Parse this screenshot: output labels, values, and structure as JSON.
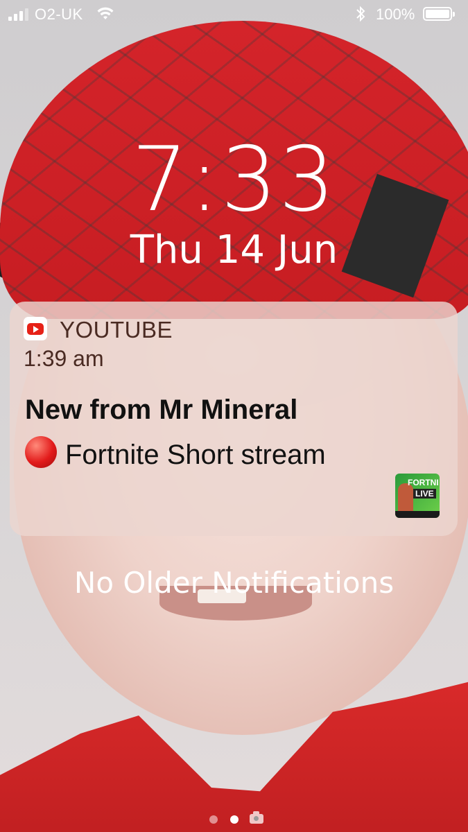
{
  "status_bar": {
    "carrier": "O2-UK",
    "signal_bars": 3,
    "signal_bars_total": 4,
    "wifi_icon": "wifi-icon",
    "bluetooth_icon": "bluetooth-icon",
    "battery_percent": "100%",
    "battery_level": 1.0
  },
  "lock_screen": {
    "time": "7:33",
    "date": "Thu 14 Jun"
  },
  "notification": {
    "app_name": "YOUTUBE",
    "app_icon": "youtube-icon",
    "time": "1:39 am",
    "title": "New from Mr Mineral",
    "body": "Fortnite Short stream",
    "body_prefix_icon": "red-circle-emoji",
    "thumbnail": {
      "line1": "FORTNI",
      "line2": "LIVE"
    }
  },
  "footer": {
    "no_older_text": "No Older Notifications",
    "page_count": 2,
    "current_page": 2,
    "camera_icon": "camera-icon"
  },
  "colors": {
    "youtube_red": "#e62117",
    "notification_bg": "#ecd6d0",
    "hat_red": "#c71d22"
  }
}
